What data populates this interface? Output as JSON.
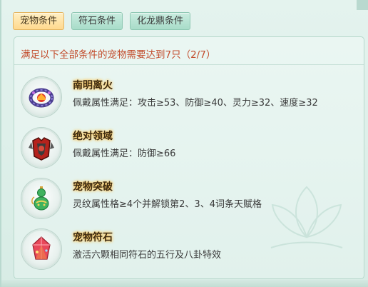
{
  "tabs": [
    {
      "label": "宠物条件",
      "active": true
    },
    {
      "label": "符石条件",
      "active": false
    },
    {
      "label": "化龙鼎条件",
      "active": false
    }
  ],
  "header": "满足以下全部条件的宠物需要达到7只（2/7）",
  "conditions": [
    {
      "title": "南明离火",
      "desc": "佩戴属性满足：攻击≥53、防御≥40、灵力≥32、速度≥32",
      "icon": "fire-ring-icon"
    },
    {
      "title": "绝对领域",
      "desc": "佩戴属性满足：防御≥66",
      "icon": "armor-icon"
    },
    {
      "title": "宠物突破",
      "desc": "灵纹属性格≥4个并解锁第2、3、4词条天赋格",
      "icon": "gourd-icon"
    },
    {
      "title": "宠物符石",
      "desc": "激活六颗相同符石的五行及八卦特效",
      "icon": "rune-crystal-icon"
    }
  ],
  "colors": {
    "header_red": "#c24a2a",
    "active_tab": "#ffd98e",
    "tab_green": "#a8dcc9",
    "title_glow": "#ffc04d"
  }
}
